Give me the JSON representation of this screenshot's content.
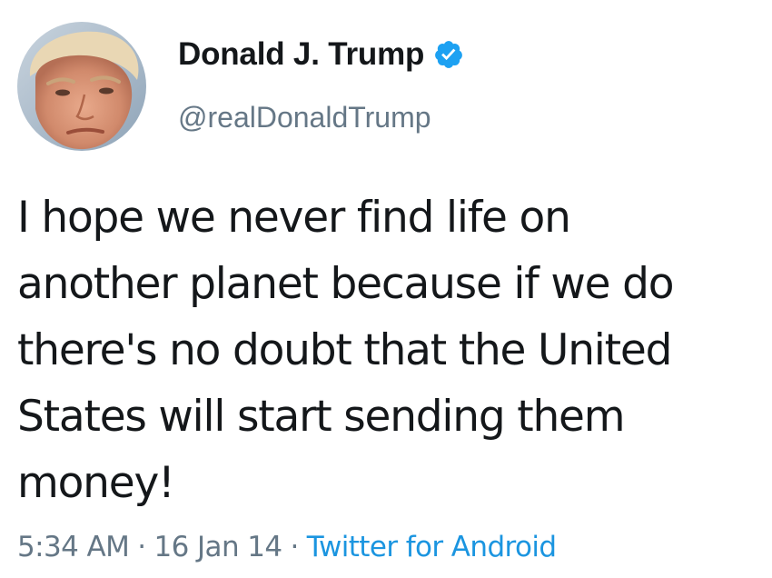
{
  "tweet": {
    "author": {
      "display_name": "Donald J. Trump",
      "handle": "@realDonaldTrump",
      "verified": true,
      "avatar_icon": "profile-photo"
    },
    "text_lines": [
      "I hope we never find life on",
      "another planet because if we do",
      "there's no doubt that the United",
      "States will start sending them",
      "money!"
    ],
    "meta": {
      "time": "5:34 AM",
      "separator": "·",
      "date": "16 Jan 14",
      "source": "Twitter for Android"
    }
  },
  "colors": {
    "text": "#14171a",
    "secondary": "#657786",
    "link": "#1b95e0",
    "verified_badge": "#1da1f2"
  }
}
